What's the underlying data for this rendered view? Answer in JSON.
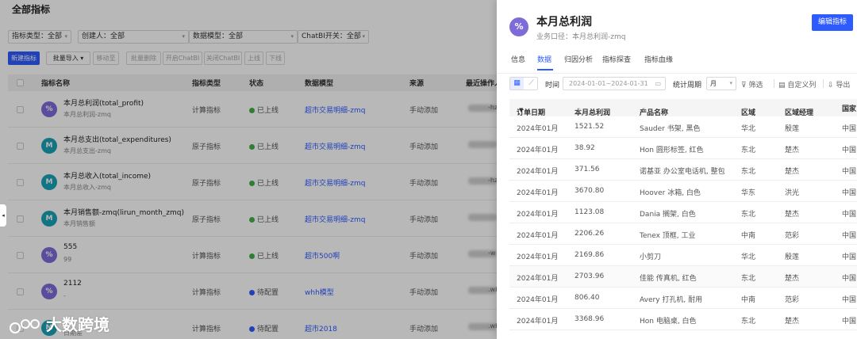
{
  "list_page": {
    "title": "全部指标",
    "filters": [
      {
        "label": "指标类型：全部"
      },
      {
        "label": "创建人：全部"
      },
      {
        "label": "数据模型：全部"
      },
      {
        "label": "ChatBI开关：全部"
      }
    ],
    "toolbar": [
      "新建指标",
      "批量导入",
      "移动至",
      "批量删除",
      "开启ChatBI",
      "关闭ChatBI",
      "上线",
      "下线"
    ],
    "columns": [
      "指标名称",
      "指标类型",
      "状态",
      "数据模型",
      "来源",
      "最近操作人"
    ],
    "rows": [
      {
        "avatar": "%",
        "name": "本月总利润(total_profit)",
        "sub": "本月总利润-zmq",
        "type": "计算指标",
        "status": "已上线",
        "status_color": "#3fb04c",
        "model": "超市交易明细-zmq",
        "source": "手动添加",
        "operator_tail": "-hz"
      },
      {
        "avatar": "M",
        "name": "本月总支出(total_expenditures)",
        "sub": "本月总支出-zmq",
        "type": "原子指标",
        "status": "已上线",
        "status_color": "#3fb04c",
        "model": "超市交易明细-zmq",
        "source": "手动添加",
        "operator_tail": ""
      },
      {
        "avatar": "M",
        "name": "本月总收入(total_income)",
        "sub": "本月总收入-zmq",
        "type": "原子指标",
        "status": "已上线",
        "status_color": "#3fb04c",
        "model": "超市交易明细-zmq",
        "source": "手动添加",
        "operator_tail": "-hz"
      },
      {
        "avatar": "M",
        "name": "本月销售额-zmq(lirun_month_zmq)",
        "sub": "本月销售额",
        "type": "原子指标",
        "status": "已上线",
        "status_color": "#3fb04c",
        "model": "超市交易明细-zmq",
        "source": "手动添加",
        "operator_tail": ""
      },
      {
        "avatar": "%",
        "name": "555",
        "sub": "99",
        "type": "计算指标",
        "status": "已上线",
        "status_color": "#3fb04c",
        "model": "超市500啊",
        "source": "手动添加",
        "operator_tail": "-w"
      },
      {
        "avatar": "%",
        "name": "2112",
        "sub": "-",
        "type": "计算指标",
        "status": "待配置",
        "status_color": "#2e5bff",
        "model": "whh模型",
        "source": "手动添加",
        "operator_tail": ".wb.x"
      },
      {
        "avatar": "M",
        "name": "",
        "sub": "日期差",
        "type": "计算指标",
        "status": "待配置",
        "status_color": "#2e5bff",
        "model": "超市2018",
        "source": "手动添加",
        "operator_tail": ".wb.x"
      }
    ]
  },
  "watermark": "大数跨境",
  "drawer": {
    "avatar": "%",
    "title": "本月总利润",
    "subtitle": "业务口径：本月总利润-zmq",
    "edit_button": "编辑指标",
    "tabs": [
      "信息",
      "数据",
      "归因分析",
      "指标探查",
      "指标血缘"
    ],
    "active_tab": "数据",
    "time_label": "时间",
    "date_range": "2024-01-01~2024-01-31",
    "period_label": "统计周期",
    "period_value": "月",
    "filter_label": "筛选",
    "custom_columns_label": "自定义列",
    "export_label": "导出",
    "columns": [
      "订单日期",
      "本月总利润",
      "产品名称",
      "区域",
      "区域经理",
      "国家"
    ],
    "rows": [
      [
        "2024年01月",
        "1521.52",
        "Sauder 书架, 黑色",
        "华北",
        "殷莲",
        "中国"
      ],
      [
        "2024年01月",
        "38.92",
        "Hon 圆形标签, 红色",
        "东北",
        "楚杰",
        "中国"
      ],
      [
        "2024年01月",
        "371.56",
        "诺基亚 办公室电话机, 整包",
        "东北",
        "楚杰",
        "中国"
      ],
      [
        "2024年01月",
        "3670.80",
        "Hoover 冰箱, 白色",
        "华东",
        "洪光",
        "中国"
      ],
      [
        "2024年01月",
        "1123.08",
        "Dania 搁架, 白色",
        "东北",
        "楚杰",
        "中国"
      ],
      [
        "2024年01月",
        "2206.26",
        "Tenex 顶框, 工业",
        "中南",
        "范彩",
        "中国"
      ],
      [
        "2024年01月",
        "2169.86",
        "小剪刀",
        "华北",
        "殷莲",
        "中国"
      ],
      [
        "2024年01月",
        "2703.96",
        "佳能 传真机, 红色",
        "东北",
        "楚杰",
        "中国"
      ],
      [
        "2024年01月",
        "806.40",
        "Avery 打孔机, 耐用",
        "中南",
        "范彩",
        "中国"
      ],
      [
        "2024年01月",
        "3368.96",
        "Hon 电脑桌, 白色",
        "东北",
        "楚杰",
        "中国"
      ]
    ]
  }
}
